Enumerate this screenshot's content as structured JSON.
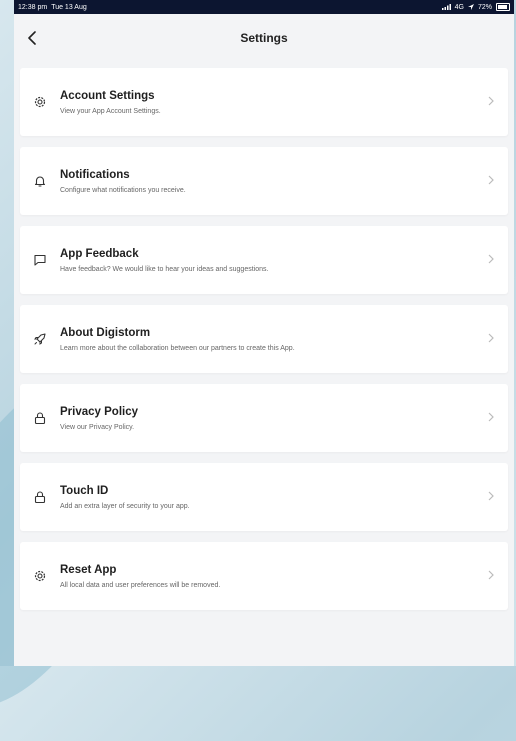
{
  "status_bar": {
    "time": "12:38 pm",
    "date": "Tue 13 Aug",
    "network": "4G",
    "battery": "72%"
  },
  "header": {
    "title": "Settings"
  },
  "items": [
    {
      "title": "Account Settings",
      "subtitle": "View your App Account Settings.",
      "icon": "gear-icon"
    },
    {
      "title": "Notifications",
      "subtitle": "Configure what notifications you receive.",
      "icon": "bell-icon"
    },
    {
      "title": "App Feedback",
      "subtitle": "Have feedback? We would like to hear your ideas and suggestions.",
      "icon": "chat-bubble-icon"
    },
    {
      "title": "About Digistorm",
      "subtitle": "Learn more about the collaboration between our partners to create this App.",
      "icon": "rocket-icon"
    },
    {
      "title": "Privacy Policy",
      "subtitle": "View our Privacy Policy.",
      "icon": "lock-icon"
    },
    {
      "title": "Touch ID",
      "subtitle": "Add an extra layer of security to your app.",
      "icon": "lock-icon"
    },
    {
      "title": "Reset App",
      "subtitle": "All local data and user preferences will be removed.",
      "icon": "gear-icon"
    }
  ],
  "colors": {
    "status_bar_bg": "#0c1530",
    "card_bg": "#ffffff",
    "page_bg": "#f3f4f6"
  }
}
